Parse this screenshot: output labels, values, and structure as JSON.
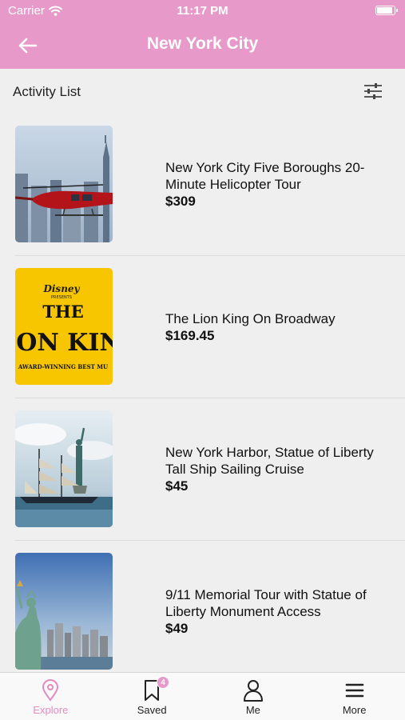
{
  "status_bar": {
    "carrier": "Carrier",
    "time": "11:17 PM"
  },
  "nav": {
    "title": "New York City"
  },
  "list_header": {
    "label": "Activity List"
  },
  "activities": [
    {
      "name": "New York City Five Boroughs 20-Minute Helicopter Tour",
      "price": "$309"
    },
    {
      "name": "The Lion King On Broadway",
      "price": "$169.45",
      "poster": {
        "brand": "Disney",
        "presents": "PRESENTS",
        "line1": "THE",
        "line2": "ION KIN",
        "tagline": "AWARD-WINNING BEST MU"
      }
    },
    {
      "name": "New York Harbor, Statue of Liberty Tall Ship Sailing Cruise",
      "price": "$45"
    },
    {
      "name": "9/11 Memorial Tour with Statue of Liberty Monument Access",
      "price": "$49"
    }
  ],
  "tabs": [
    {
      "label": "Explore",
      "icon": "map-pin-icon",
      "active": true
    },
    {
      "label": "Saved",
      "icon": "bookmark-icon",
      "badge": "4"
    },
    {
      "label": "Me",
      "icon": "person-icon"
    },
    {
      "label": "More",
      "icon": "menu-icon"
    }
  ],
  "colors": {
    "accent": "#e79ac9",
    "active_tab": "#e48bc2",
    "background": "#efefef"
  }
}
